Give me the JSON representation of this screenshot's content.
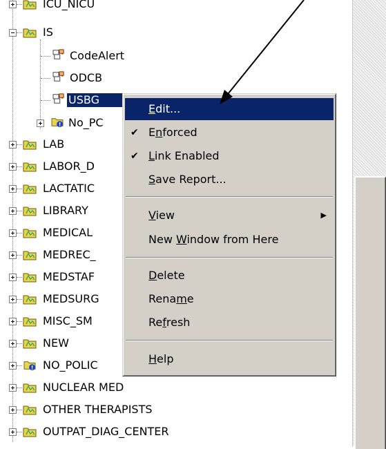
{
  "tree": {
    "items": [
      {
        "label": "ICU_NICU",
        "icon": "folder-icon"
      },
      {
        "label": "IS",
        "icon": "folder-icon"
      },
      {
        "label": "CodeAlert",
        "icon": "gpo-link-icon"
      },
      {
        "label": "ODCB",
        "icon": "gpo-link-icon"
      },
      {
        "label": "USBG",
        "icon": "gpo-link-icon"
      },
      {
        "label": "No_PC",
        "icon": "blocked-folder-icon"
      },
      {
        "label": "LAB",
        "icon": "folder-icon"
      },
      {
        "label": "LABOR_D",
        "icon": "folder-icon"
      },
      {
        "label": "LACTATIC",
        "icon": "folder-icon"
      },
      {
        "label": "LIBRARY",
        "icon": "folder-icon"
      },
      {
        "label": "MEDICAL",
        "icon": "folder-icon"
      },
      {
        "label": "MEDREC_",
        "icon": "folder-icon"
      },
      {
        "label": "MEDSTAF",
        "icon": "folder-icon"
      },
      {
        "label": "MEDSURG",
        "icon": "folder-icon"
      },
      {
        "label": "MISC_SM",
        "icon": "folder-icon"
      },
      {
        "label": "NEW",
        "icon": "folder-icon"
      },
      {
        "label": "NO_POLIC",
        "icon": "blocked-folder-icon"
      },
      {
        "label": "NUCLEAR MED",
        "icon": "folder-icon"
      },
      {
        "label": "OTHER THERAPISTS",
        "icon": "folder-icon"
      },
      {
        "label": "OUTPAT_DIAG_CENTER",
        "icon": "folder-icon"
      }
    ]
  },
  "context_menu": {
    "items": [
      {
        "label": "Edit...",
        "mnemonic": "E",
        "checked": false,
        "highlighted": true
      },
      {
        "label": "Enforced",
        "mnemonic": "n",
        "checked": true
      },
      {
        "label": "Link Enabled",
        "mnemonic": "L",
        "checked": true
      },
      {
        "label": "Save Report...",
        "mnemonic": "S",
        "checked": false
      },
      {
        "label": "View",
        "mnemonic": "V",
        "has_submenu": true
      },
      {
        "label": "New Window from Here",
        "mnemonic": "W"
      },
      {
        "label": "Delete",
        "mnemonic": "D"
      },
      {
        "label": "Rename",
        "mnemonic": "m"
      },
      {
        "label": "Refresh",
        "mnemonic": "f"
      },
      {
        "label": "Help",
        "mnemonic": "H"
      }
    ],
    "check_glyph": "✔",
    "submenu_glyph": "▶"
  },
  "colors": {
    "highlight": "#0a246a",
    "menu_face": "#d4d0c8",
    "folder_yellow": "#e8d44d"
  }
}
